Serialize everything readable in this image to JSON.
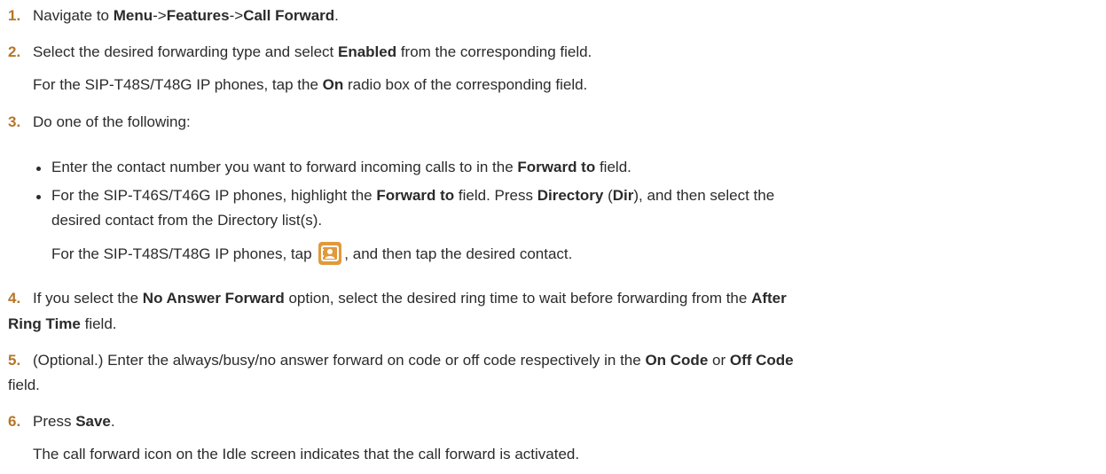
{
  "steps": [
    {
      "num": "1.",
      "line1": {
        "t1": "Navigate to ",
        "b1": "Menu",
        "t2": "->",
        "b2": "Features",
        "t3": "->",
        "b3": "Call Forward",
        "t4": "."
      }
    },
    {
      "num": "2.",
      "line1": {
        "t1": "Select the desired forwarding type and select ",
        "b1": "Enabled",
        "t2": " from the corresponding field."
      },
      "line2": {
        "t1": "For the SIP-T48S/T48G IP phones, tap the ",
        "b1": "On",
        "t2": " radio box of the corresponding field."
      }
    },
    {
      "num": "3.",
      "line1": {
        "t1": "Do one of the following:"
      },
      "bullets": [
        {
          "t1": "Enter the contact number you want to forward incoming calls to in the ",
          "b1": "Forward to",
          "t2": " field."
        },
        {
          "t1": "For the SIP-T46S/T46G IP phones, highlight the  ",
          "b1": "Forward to",
          "t2": " field. Press ",
          "b2": "Directory",
          "t3": " (",
          "b3": "Dir",
          "t4": "), and then select the",
          "cont": "desired contact from the Directory list(s)."
        }
      ],
      "sub": {
        "t1": "For the SIP-T48S/T48G IP phones, tap ",
        "icon": "contact-book-icon",
        "t2": ", and then tap the desired contact."
      }
    },
    {
      "num": "4.",
      "line1": {
        "t1": "If you select the ",
        "b1": "No Answer Forward",
        "t2": " option, select the desired ring time to wait before forwarding from the ",
        "b2": "After"
      },
      "line2": {
        "b1": "Ring Time",
        "t1": " field."
      }
    },
    {
      "num": "5.",
      "line1": {
        "t1": "(Optional.) Enter the always/busy/no answer forward on code or off code respectively in the ",
        "b1": "On Code",
        "t2": " or ",
        "b2": "Off Code"
      },
      "line2": {
        "t1": "field."
      }
    },
    {
      "num": "6.",
      "line1": {
        "t1": "Press ",
        "b1": "Save",
        "t2": "."
      },
      "line2": {
        "t1": "The call forward icon on the Idle screen indicates that the call forward is activated."
      }
    }
  ],
  "colors": {
    "step_number": "#b5762a",
    "icon_background": "#e09a3c",
    "text": "#2b2b2b"
  }
}
